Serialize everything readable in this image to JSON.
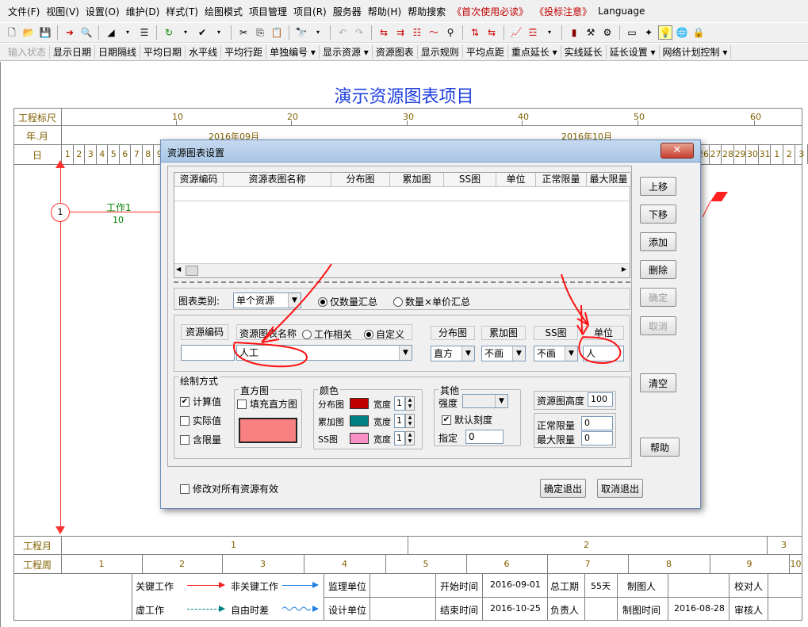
{
  "menu": [
    "文件(F)",
    "视图(V)",
    "设置(O)",
    "维护(D)",
    "样式(T)",
    "绘图模式",
    "项目管理",
    "项目(R)",
    "服务器",
    "帮助(H)",
    "帮助搜索",
    "《首次使用必读》",
    "《投标注意》",
    "Language"
  ],
  "toolbar2": [
    "输入状态",
    "显示日期",
    "日期隔线",
    "平均日期",
    "水平线",
    "平均行距",
    "单独编号 ▾",
    "显示资源 ▾",
    "资源图表",
    "显示规则",
    "平均点距",
    "重点延长 ▾",
    "实线延长",
    "延长设置 ▾",
    "网络计划控制 ▾"
  ],
  "chart": {
    "title": "演示资源图表项目",
    "row_labels": {
      "ruler": "工程标尺",
      "month": "年.月",
      "day": "日"
    },
    "ruler_ticks": [
      "10",
      "20",
      "30",
      "40",
      "50",
      "60"
    ],
    "months": [
      "2016年09月",
      "2016年10月"
    ],
    "days_left": [
      "1",
      "2",
      "3",
      "4",
      "5",
      "6",
      "7",
      "8",
      "9"
    ],
    "days_right": [
      "26",
      "27",
      "28",
      "29",
      "30",
      "31",
      "1",
      "2",
      "3"
    ],
    "node_number": "1",
    "task_name": "工作1",
    "task_duration": "10",
    "bottom_labels": {
      "month": "工程月",
      "week": "工程周"
    },
    "project_months": [
      "1",
      "2",
      "3"
    ],
    "project_weeks": [
      "1",
      "2",
      "3",
      "4",
      "5",
      "6",
      "7",
      "8",
      "9",
      "10"
    ]
  },
  "legend": {
    "critical": "关键工作",
    "noncritical": "非关键工作",
    "supervisor": "监理单位",
    "dummy": "虚工作",
    "freefloat": "自由时差",
    "designer": "设计单位",
    "start_label": "开始时间",
    "start_value": "2016-09-01",
    "total_label": "总工期",
    "total_value": "55天",
    "drawer": "制图人",
    "checker": "校对人",
    "end_label": "结束时间",
    "end_value": "2016-10-25",
    "owner": "负责人",
    "draw_time_label": "制图时间",
    "draw_time_value": "2016-08-28",
    "reviewer": "审核人"
  },
  "dialog": {
    "title": "资源图表设置",
    "close": "✕",
    "grid_headers": [
      "资源编码",
      "资源表图名称",
      "分布图",
      "累加图",
      "SS图",
      "单位",
      "正常限量",
      "最大限量"
    ],
    "side_buttons": [
      "上移",
      "下移",
      "添加",
      "删除",
      "确定",
      "取消",
      "清空",
      "帮助"
    ],
    "chart_type_label": "图表类别:",
    "chart_type_value": "单个资源",
    "radio_qty": "仅数量汇总",
    "radio_qty_price": "数量×单价汇总",
    "field_code": "资源编码",
    "field_name": "资源图表名称",
    "radio_related": "工作相关",
    "radio_custom": "自定义",
    "field_dist": "分布图",
    "field_accum": "累加图",
    "field_ss": "SS图",
    "field_unit": "单位",
    "code_value": "",
    "name_value": "人工",
    "dist_value": "直方",
    "accum_value": "不画",
    "ss_value": "不画",
    "unit_value": "人",
    "draw_mode": "绘制方式",
    "chk_calc": "计算值",
    "chk_actual": "实际值",
    "chk_limit": "含限量",
    "hist_group": "直方图",
    "fill_hist": "填充直方图",
    "color_group": "颜色",
    "color_dist": "分布图",
    "color_accum": "累加图",
    "color_ss": "SS图",
    "width_label": "宽度",
    "width_value": "1",
    "other_group": "其他",
    "intensity": "强度",
    "default_scale": "默认刻度",
    "specify": "指定",
    "specify_value": "0",
    "height_label": "资源图高度",
    "height_value": "100",
    "normal_limit": "正常限量",
    "normal_value": "0",
    "max_limit": "最大限量",
    "max_value": "0",
    "modify_all": "修改对所有资源有效",
    "ok_exit": "确定退出",
    "cancel_exit": "取消退出"
  },
  "colors": {
    "hist": "#f88080",
    "dist": "#c00000",
    "accum": "#008080",
    "ss": "#f890c8",
    "title": "#2040e0",
    "annotation": "#ff0000"
  }
}
